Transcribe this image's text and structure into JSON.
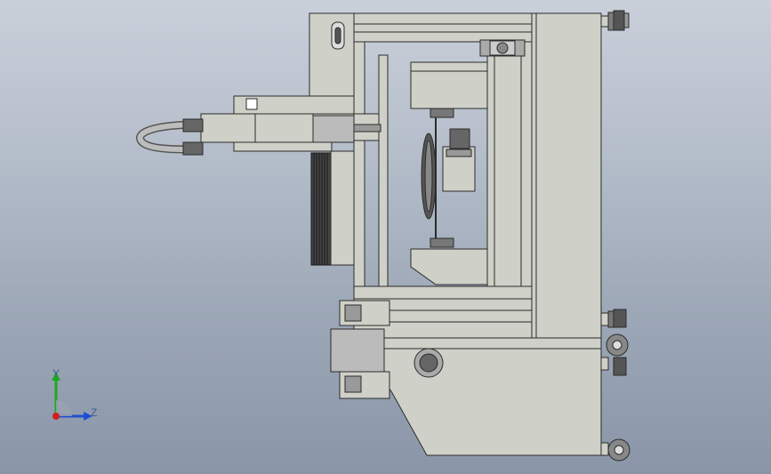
{
  "viewport": {
    "background_top": "#c9d0da",
    "background_bottom": "#8a96a8"
  },
  "model": {
    "frame_color": "#cfd0c7",
    "edge_color": "#2b2b2b",
    "dark_part_color": "#3a3a3a",
    "metal_color": "#b8b8b0"
  },
  "triad": {
    "y_axis_label": "Y",
    "z_axis_label": "Z",
    "y_axis_color": "#1fa81f",
    "z_axis_color": "#1f4fd1",
    "x_axis_color": "#d11f1f"
  }
}
